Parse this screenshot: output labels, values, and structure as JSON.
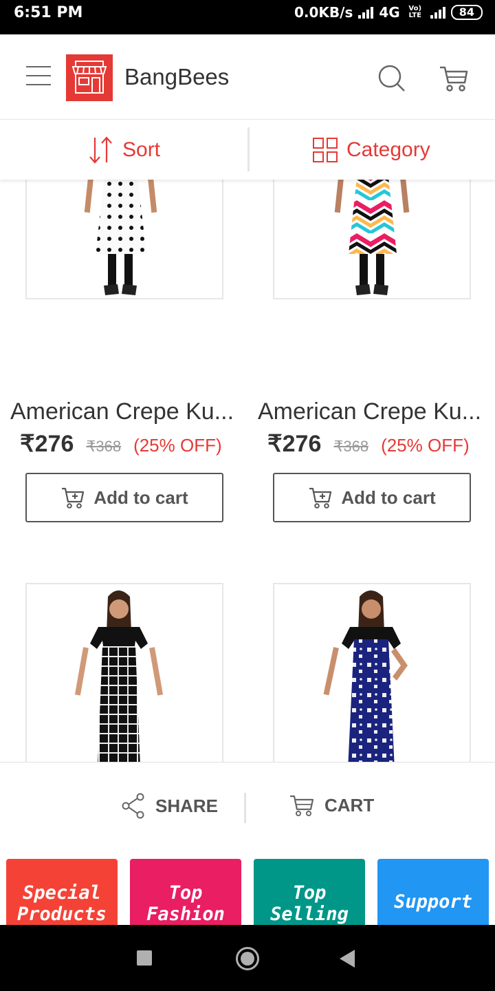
{
  "status_bar": {
    "time": "6:51 PM",
    "network_speed": "0.0KB/s",
    "network_type": "4G",
    "volte": "Vo) LTE",
    "battery": "84"
  },
  "app_bar": {
    "title": "BangBees",
    "menu_icon": "hamburger-menu-icon",
    "logo_icon": "storefront-icon",
    "search_icon": "search-icon",
    "cart_icon": "cart-icon"
  },
  "filters": {
    "sort_label": "Sort",
    "sort_icon": "sort-arrows-icon",
    "category_label": "Category",
    "category_icon": "grid-icon"
  },
  "products": [
    {
      "name": "American Crepe Ku...",
      "price": "₹276",
      "mrp": "₹368",
      "discount": "(25% OFF)",
      "button": "Add to cart",
      "pattern": "white-polka-dot"
    },
    {
      "name": "American Crepe Ku...",
      "price": "₹276",
      "mrp": "₹368",
      "discount": "(25% OFF)",
      "button": "Add to cart",
      "pattern": "multicolor-chevron"
    },
    {
      "name": "",
      "price": "",
      "mrp": "",
      "discount": "",
      "button": "",
      "pattern": "black-white-check"
    },
    {
      "name": "",
      "price": "",
      "mrp": "",
      "discount": "",
      "button": "",
      "pattern": "navy-white-print"
    }
  ],
  "actions": {
    "share_label": "SHARE",
    "share_icon": "share-icon",
    "cart_label": "CART",
    "cart_icon": "cart-icon"
  },
  "tiles": [
    {
      "line1": "Special",
      "line2": "Products",
      "color": "#f44336"
    },
    {
      "line1": "Top",
      "line2": "Fashion",
      "color": "#e91e63"
    },
    {
      "line1": "Top",
      "line2": "Selling",
      "color": "#009688"
    },
    {
      "line1": "Support",
      "line2": "",
      "color": "#2196f3"
    }
  ],
  "colors": {
    "accent": "#e53935",
    "text": "#333333",
    "muted": "#999999"
  }
}
